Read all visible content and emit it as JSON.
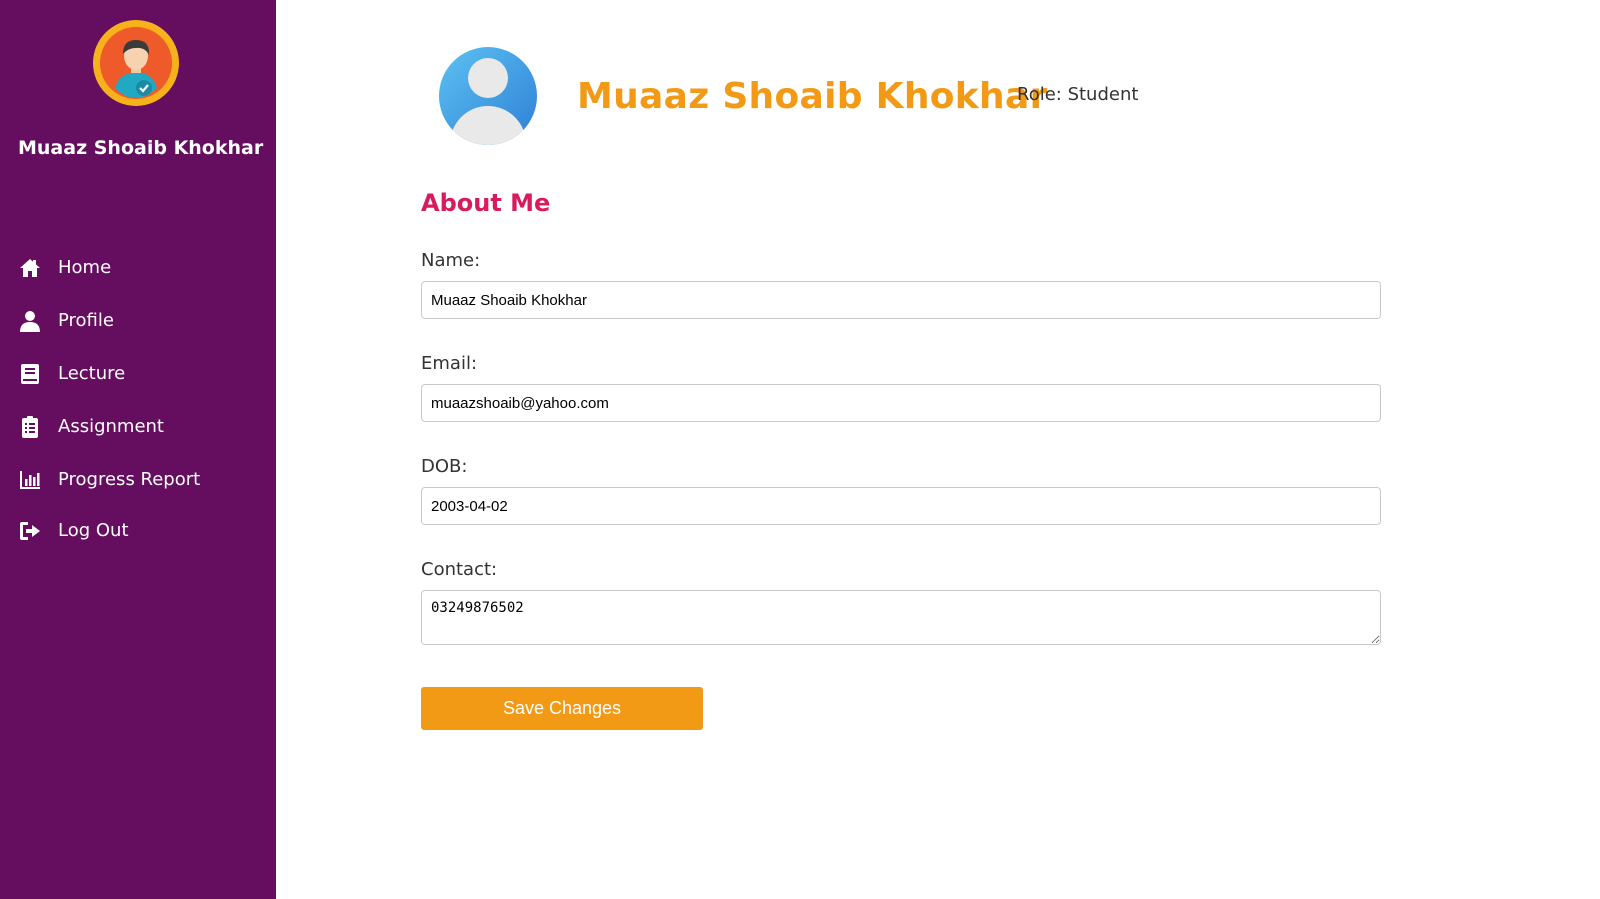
{
  "sidebar": {
    "username": "Muaaz Shoaib Khokhar",
    "avatar_icon": "student-avatar-icon",
    "items": [
      {
        "label": "Home",
        "icon": "home-icon"
      },
      {
        "label": "Profile",
        "icon": "user-icon"
      },
      {
        "label": "Lecture",
        "icon": "book-icon"
      },
      {
        "label": "Assignment",
        "icon": "clipboard-icon"
      },
      {
        "label": "Progress Report",
        "icon": "bar-chart-icon"
      },
      {
        "label": "Log Out",
        "icon": "sign-out-icon"
      }
    ]
  },
  "profile": {
    "name": "Muaaz Shoaib Khokhar",
    "role": "Role: Student",
    "avatar_icon": "user-avatar-icon"
  },
  "about": {
    "title": "About Me",
    "name_label": "Name:",
    "name_value": "Muaaz Shoaib Khokhar",
    "email_label": "Email:",
    "email_value": "muaazshoaib@yahoo.com",
    "dob_label": "DOB:",
    "dob_value": "2003-04-02",
    "contact_label": "Contact:",
    "contact_value": "03249876502",
    "save_label": "Save Changes"
  },
  "colors": {
    "sidebar_bg": "#650d5f",
    "accent_orange": "#f29a15",
    "heading_pink": "#d81b5e"
  }
}
